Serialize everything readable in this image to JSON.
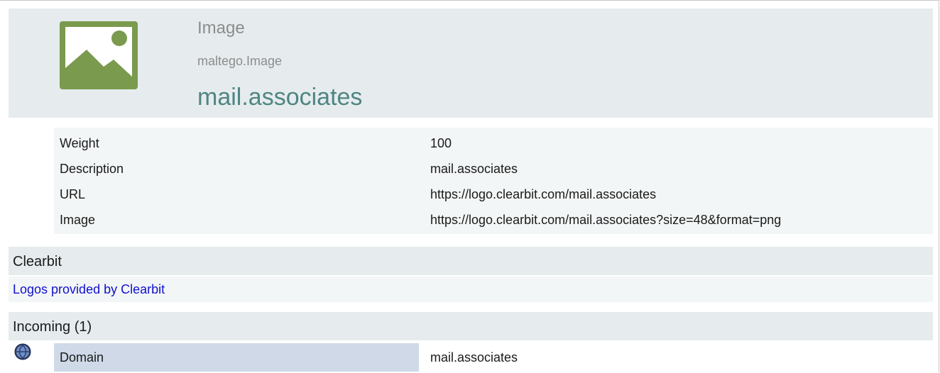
{
  "entity": {
    "type": "Image",
    "class": "maltego.Image",
    "value": "mail.associates",
    "thumbnail_icon": "image-placeholder-icon"
  },
  "properties": [
    {
      "key": "Weight",
      "value": "100"
    },
    {
      "key": "Description",
      "value": "mail.associates"
    },
    {
      "key": "URL",
      "value": "https://logo.clearbit.com/mail.associates"
    },
    {
      "key": "Image",
      "value": "https://logo.clearbit.com/mail.associates?size=48&format=png"
    }
  ],
  "clearbit": {
    "title": "Clearbit",
    "link_text": "Logos provided by Clearbit"
  },
  "incoming": {
    "title": "Incoming (1)",
    "items": [
      {
        "icon": "globe-icon",
        "type": "Domain",
        "value": "mail.associates"
      }
    ]
  },
  "colors": {
    "header_bg": "#e6ecee",
    "row_bg": "#f3f6f6",
    "accent_teal": "#4f8582",
    "link_blue": "#1111cc",
    "incoming_type_bg": "#cfd9e8"
  }
}
